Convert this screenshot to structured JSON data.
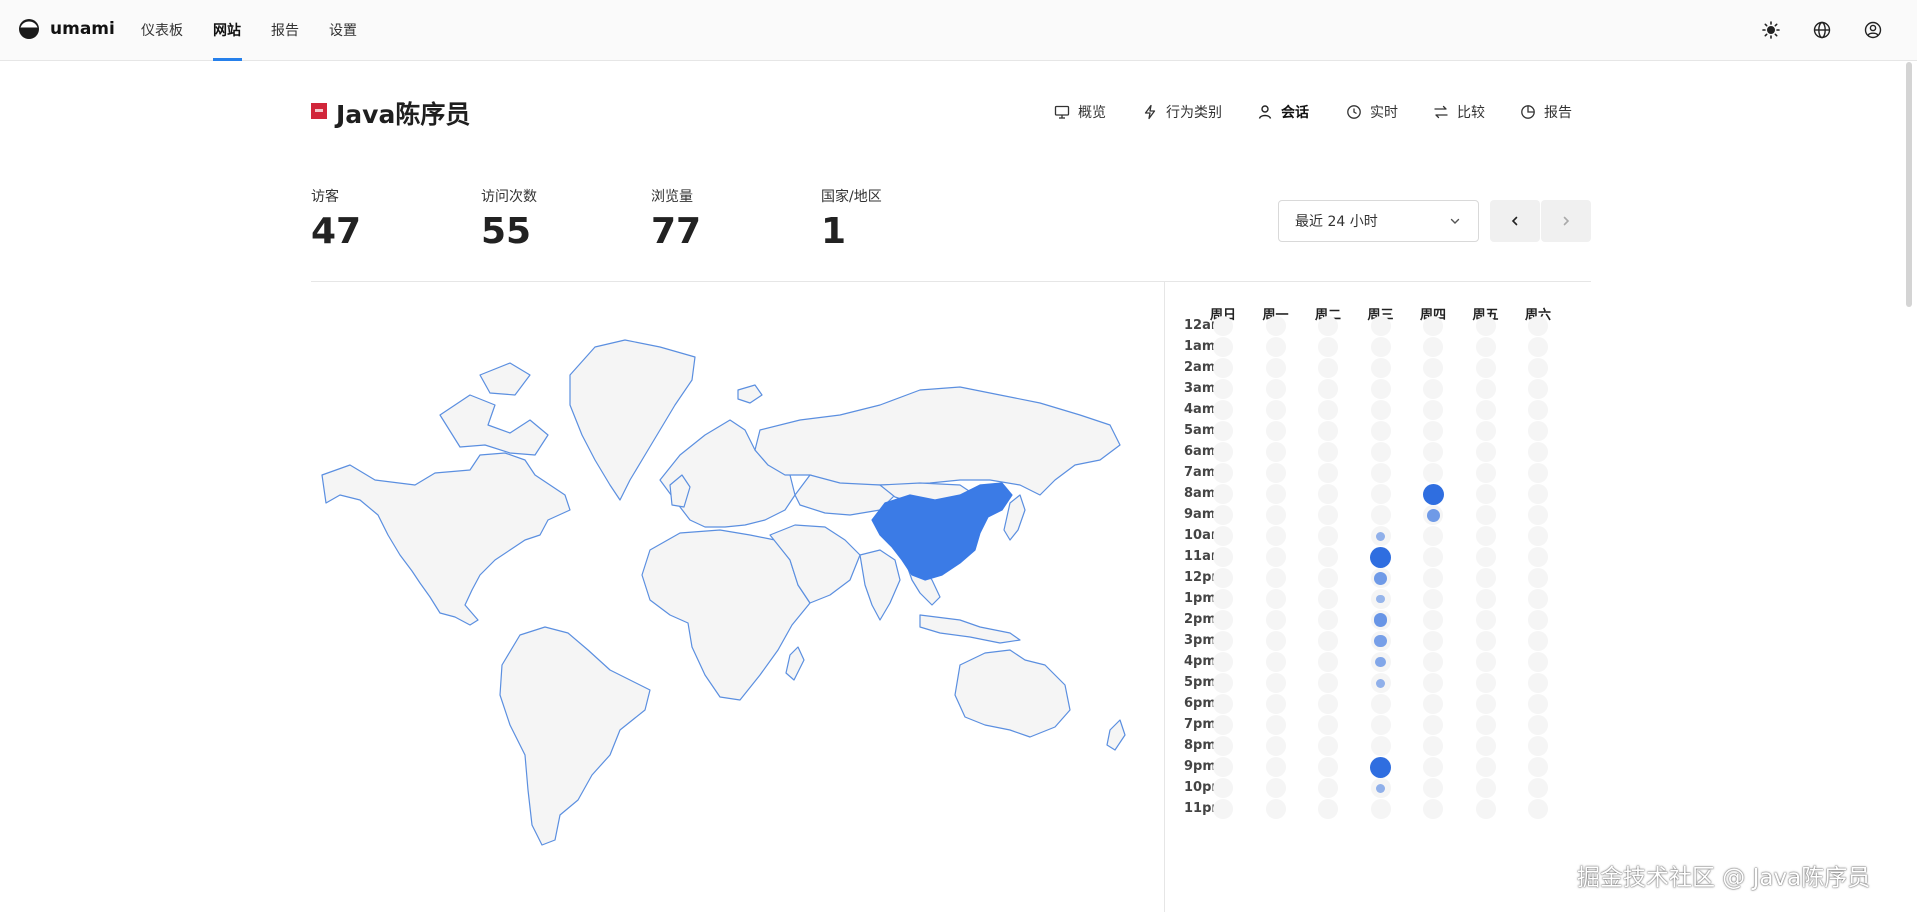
{
  "app": {
    "brand_name": "umami",
    "nav": [
      {
        "label": "仪表板",
        "active": false
      },
      {
        "label": "网站",
        "active": true
      },
      {
        "label": "报告",
        "active": false
      },
      {
        "label": "设置",
        "active": false
      }
    ],
    "top_icons": [
      "theme-sun-icon",
      "language-globe-icon",
      "profile-icon"
    ]
  },
  "website": {
    "title": "Java陈序员",
    "tabs": [
      {
        "label": "概览",
        "icon": "monitor-icon",
        "active": false
      },
      {
        "label": "行为类别",
        "icon": "lightning-icon",
        "active": false
      },
      {
        "label": "会话",
        "icon": "user-icon",
        "active": true
      },
      {
        "label": "实时",
        "icon": "clock-icon",
        "active": false
      },
      {
        "label": "比较",
        "icon": "compare-arrows-icon",
        "active": false
      },
      {
        "label": "报告",
        "icon": "pie-report-icon",
        "active": false
      }
    ]
  },
  "metrics": [
    {
      "label": "访客",
      "value": "47"
    },
    {
      "label": "访问次数",
      "value": "55"
    },
    {
      "label": "浏览量",
      "value": "77"
    },
    {
      "label": "国家/地区",
      "value": "1"
    }
  ],
  "date_range": {
    "selected": "最近 24 小时"
  },
  "map": {
    "highlighted_country": "China",
    "highlight_color": "#3b7be6",
    "land_color": "#f5f5f5",
    "border_color": "#5b8fe0"
  },
  "heatmap": {
    "days": [
      "周日",
      "周一",
      "周二",
      "周三",
      "周四",
      "周五",
      "周六"
    ],
    "hours": [
      "12am",
      "1am",
      "2am",
      "3am",
      "4am",
      "5am",
      "6am",
      "7am",
      "8am",
      "9am",
      "10am",
      "11am",
      "12pm",
      "1pm",
      "2pm",
      "3pm",
      "4pm",
      "5pm",
      "6pm",
      "7pm",
      "8pm",
      "9pm",
      "10pm",
      "11pm"
    ],
    "accent": "#2f6ee0",
    "cells": [
      {
        "day": 4,
        "hour": 8,
        "level": 1.0
      },
      {
        "day": 4,
        "hour": 9,
        "level": 0.5
      },
      {
        "day": 3,
        "hour": 10,
        "level": 0.25
      },
      {
        "day": 3,
        "hour": 11,
        "level": 1.0
      },
      {
        "day": 3,
        "hour": 12,
        "level": 0.5
      },
      {
        "day": 3,
        "hour": 13,
        "level": 0.2
      },
      {
        "day": 3,
        "hour": 14,
        "level": 0.55
      },
      {
        "day": 3,
        "hour": 15,
        "level": 0.45
      },
      {
        "day": 3,
        "hour": 16,
        "level": 0.35
      },
      {
        "day": 3,
        "hour": 17,
        "level": 0.25
      },
      {
        "day": 3,
        "hour": 21,
        "level": 1.0
      },
      {
        "day": 3,
        "hour": 22,
        "level": 0.25
      }
    ]
  },
  "watermark": "掘金技术社区 @ Java陈序员"
}
